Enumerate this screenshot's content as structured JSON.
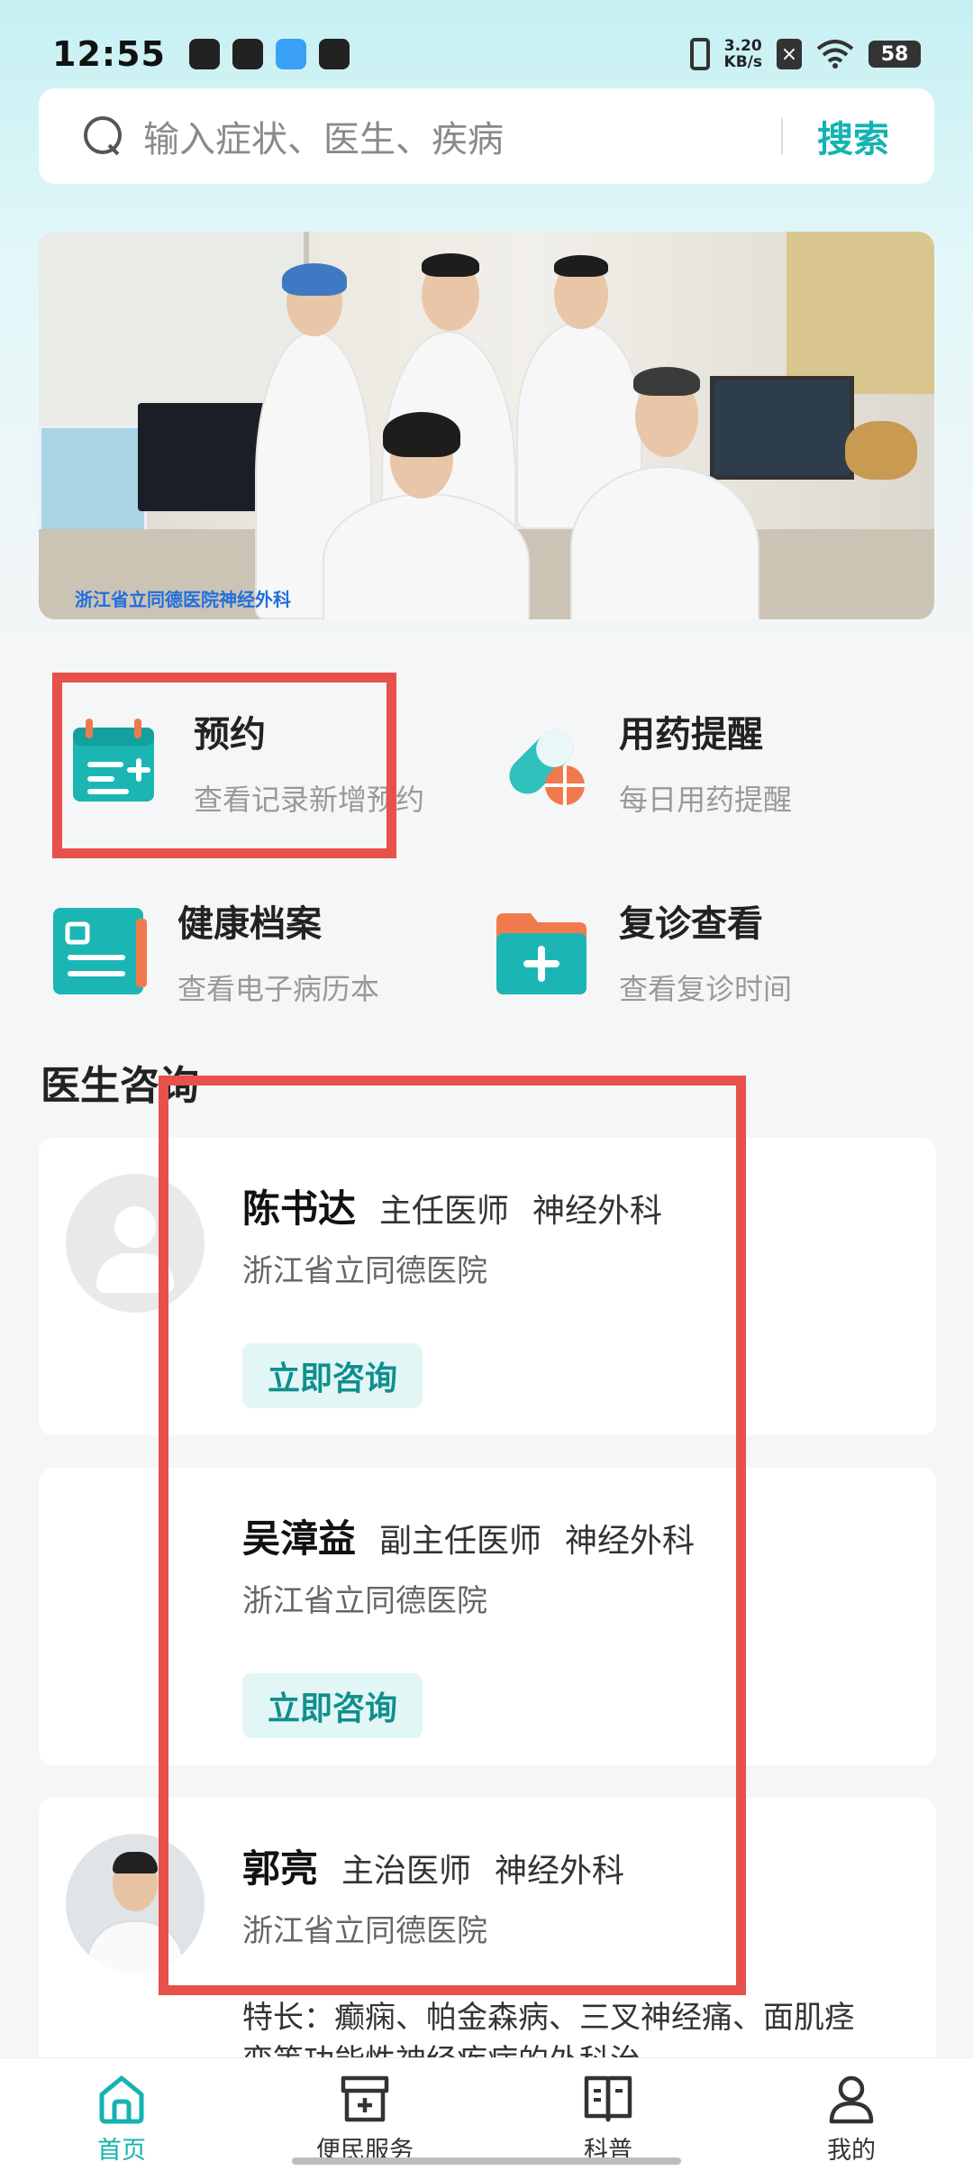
{
  "status_bar": {
    "time": "12:55",
    "speed_top": "3.20",
    "speed_bottom": "KB/s",
    "battery": "58"
  },
  "search": {
    "placeholder": "输入症状、医生、疾病",
    "button": "搜索"
  },
  "banner": {
    "caption": "浙江省立同德医院神经外科"
  },
  "services": [
    {
      "title": "预约",
      "subtitle": "查看记录新增预约",
      "icon": "calendar-icon"
    },
    {
      "title": "用药提醒",
      "subtitle": "每日用药提醒",
      "icon": "pill-icon"
    },
    {
      "title": "健康档案",
      "subtitle": "查看电子病历本",
      "icon": "health-record-icon"
    },
    {
      "title": "复诊查看",
      "subtitle": "查看复诊时间",
      "icon": "folder-plus-icon"
    }
  ],
  "doctor_section": {
    "title": "医生咨询"
  },
  "doctors": [
    {
      "name": "陈书达",
      "title": "主任医师",
      "dept": "神经外科",
      "hospital": "浙江省立同德医院",
      "button": "立即咨询"
    },
    {
      "name": "吴漳益",
      "title": "副主任医师",
      "dept": "神经外科",
      "hospital": "浙江省立同德医院",
      "button": "立即咨询"
    },
    {
      "name": "郭亮",
      "title": "主治医师",
      "dept": "神经外科",
      "hospital": "浙江省立同德医院",
      "specialty": "特长：癫痫、帕金森病、三叉神经痛、面肌痉挛等功能性神经疾病的外科治…"
    }
  ],
  "bottom_nav": [
    {
      "label": "首页",
      "icon": "home-icon",
      "active": true
    },
    {
      "label": "便民服务",
      "icon": "service-icon",
      "active": false
    },
    {
      "label": "科普",
      "icon": "book-icon",
      "active": false
    },
    {
      "label": "我的",
      "icon": "user-icon",
      "active": false
    }
  ],
  "colors": {
    "accent": "#14b3b1",
    "annotation_red": "#e8504a"
  }
}
